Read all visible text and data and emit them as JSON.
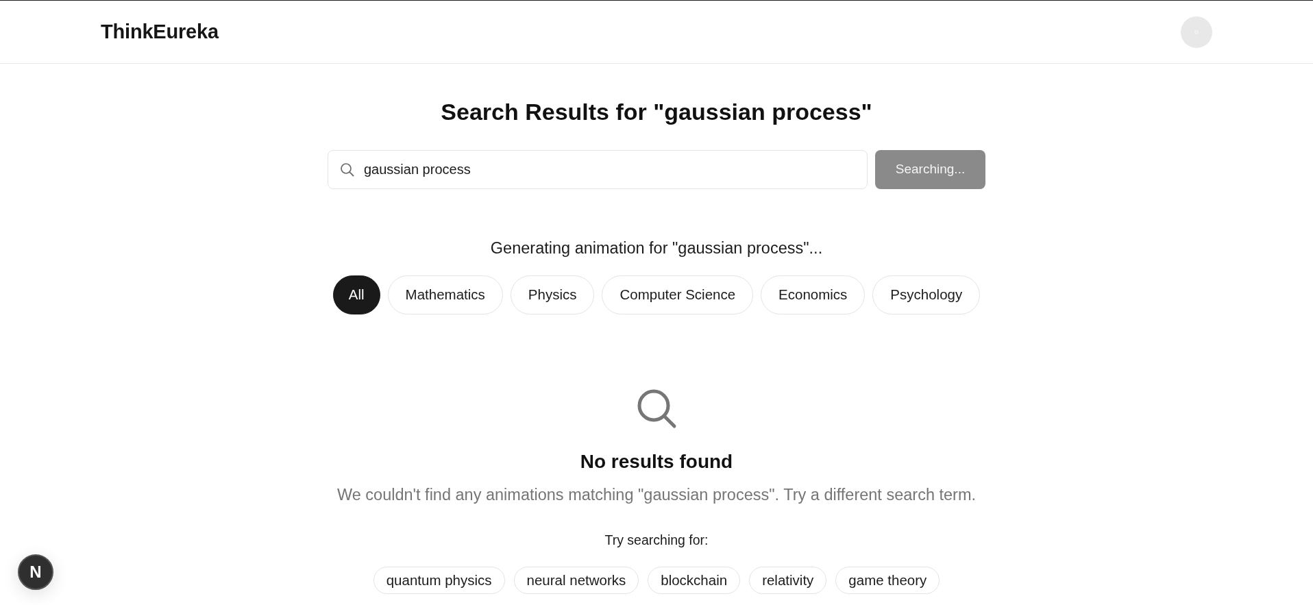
{
  "header": {
    "logo": "ThinkEureka"
  },
  "title": "Search Results for \"gaussian process\"",
  "search": {
    "value": "gaussian process",
    "button": {
      "label": "Searching...",
      "disabled": true
    }
  },
  "status": "Generating animation for \"gaussian process\"...",
  "categories": [
    {
      "label": "All",
      "selected": true
    },
    {
      "label": "Mathematics",
      "selected": false
    },
    {
      "label": "Physics",
      "selected": false
    },
    {
      "label": "Computer Science",
      "selected": false
    },
    {
      "label": "Economics",
      "selected": false
    },
    {
      "label": "Psychology",
      "selected": false
    }
  ],
  "empty_state": {
    "title": "No results found",
    "message": "We couldn't find any animations matching \"gaussian process\". Try a different search term."
  },
  "suggestions": {
    "heading": "Try searching for:",
    "items": [
      "quantum physics",
      "neural networks",
      "blockchain",
      "relativity",
      "game theory"
    ]
  },
  "dev_badge": {
    "label": "N"
  }
}
